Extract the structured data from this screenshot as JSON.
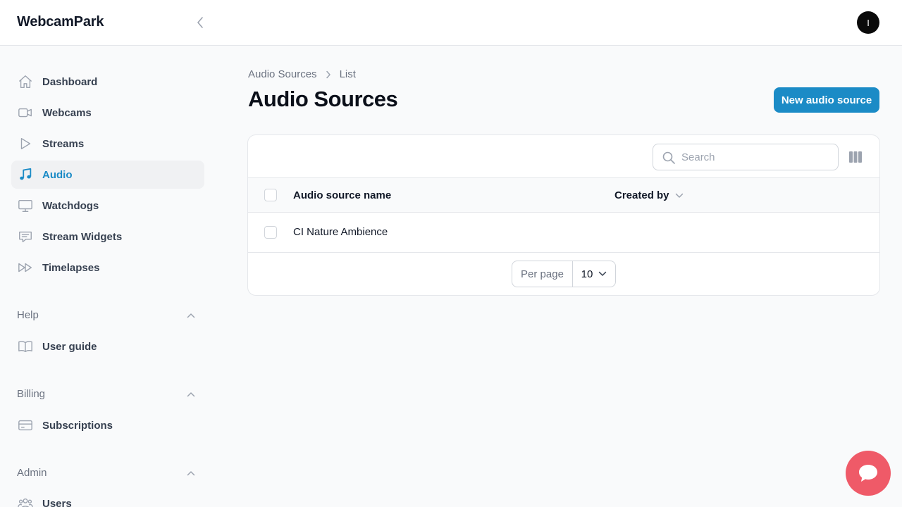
{
  "app": {
    "brand": "WebcamPark",
    "avatar_initial": "I"
  },
  "sidebar": {
    "items": [
      {
        "label": "Dashboard",
        "icon": "home-icon"
      },
      {
        "label": "Webcams",
        "icon": "video-camera-icon"
      },
      {
        "label": "Streams",
        "icon": "play-icon"
      },
      {
        "label": "Audio",
        "icon": "music-note-icon",
        "active": true
      },
      {
        "label": "Watchdogs",
        "icon": "monitor-icon"
      },
      {
        "label": "Stream Widgets",
        "icon": "chat-bubble-icon"
      },
      {
        "label": "Timelapses",
        "icon": "fast-forward-icon"
      }
    ],
    "groups": [
      {
        "label": "Help",
        "items": [
          {
            "label": "User guide",
            "icon": "book-open-icon"
          }
        ]
      },
      {
        "label": "Billing",
        "items": [
          {
            "label": "Subscriptions",
            "icon": "credit-card-icon"
          }
        ]
      },
      {
        "label": "Admin",
        "items": [
          {
            "label": "Users",
            "icon": "users-icon"
          }
        ]
      }
    ]
  },
  "breadcrumb": [
    "Audio Sources",
    "List"
  ],
  "page": {
    "title": "Audio Sources",
    "primary_action": "New audio source"
  },
  "table": {
    "search_placeholder": "Search",
    "columns": [
      "Audio source name",
      "Created by"
    ],
    "rows": [
      {
        "name": "CI Nature Ambience",
        "created_by": ""
      }
    ],
    "pagination": {
      "per_page_label": "Per page",
      "per_page_value": "10"
    }
  },
  "colors": {
    "accent": "#1b8bc6",
    "chat": "#ef5a68",
    "active_bg": "#f0f1f3"
  }
}
